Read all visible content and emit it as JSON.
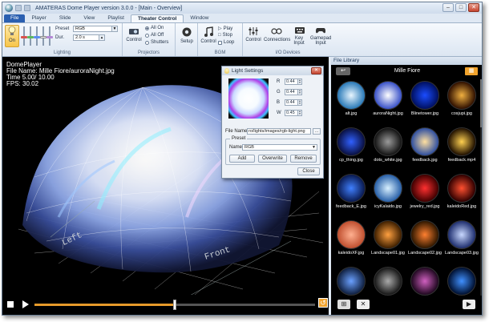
{
  "window": {
    "title": "AMATERAS Dome Player version 3.0.0 - [Main - Overview]",
    "colors": {
      "accent": "#f1a32d",
      "ribbon_blue": "#2a5fb0"
    }
  },
  "tabs": [
    {
      "label": "File"
    },
    {
      "label": "Player"
    },
    {
      "label": "Slide"
    },
    {
      "label": "View"
    },
    {
      "label": "Playlist"
    },
    {
      "label": "Theater Control"
    },
    {
      "label": "Window"
    }
  ],
  "ribbon": {
    "lighting": {
      "label": "Lighting",
      "on_label": "On",
      "preset_label": "Preset",
      "preset_value": "RGB",
      "dur_label": "Dur.",
      "dur_value": "2.0 s"
    },
    "projectors": {
      "label": "Projectors",
      "control_label": "Control",
      "all_on": "All On",
      "all_off": "All Off",
      "shutters": "Shutters"
    },
    "setup": {
      "label": "Setup"
    },
    "bgm": {
      "label": "BGM",
      "control_label": "Control",
      "play": "Play",
      "stop": "Stop",
      "loop": "Loop"
    },
    "io": {
      "label": "I/O Devices",
      "control": "Control",
      "connections": "Connections",
      "key_input": "Key Input",
      "gamepad_input": "Gamepad Input"
    }
  },
  "viewport": {
    "player_name": "DomePlayer",
    "file_line": "File Name: Mille Fiore/auroraNight.jpg",
    "time_line": "Time    5.00/ 10.00",
    "fps_line": "FPS: 30.02",
    "label_left": "Left",
    "label_front": "Front"
  },
  "transport": {
    "progress": 0.5,
    "stop_icon": "stop-icon",
    "play_icon": "play-icon",
    "loop_icon": "loop-icon"
  },
  "light_settings": {
    "title": "Light Settings",
    "r_label": "R",
    "r_value": "0.44",
    "g_label": "G",
    "g_value": "0.44",
    "b_label": "B",
    "b_value": "0.44",
    "w_label": "W",
    "w_value": "0.45",
    "file_name_label": "File Name",
    "file_name_value": "ro/lights/images/rgb-light.png",
    "preset_group": "Preset",
    "name_label": "Name",
    "name_value": "RGB",
    "add_label": "Add",
    "overwrite_label": "Overwrite",
    "remove_label": "Remove",
    "close_label": "Close"
  },
  "library": {
    "title": "File Library",
    "folder": "Mille Fiore",
    "items": [
      {
        "name": "alt.jpg",
        "c1": "#e8f6ff",
        "c2": "#2a7ab8"
      },
      {
        "name": "auroraNight.jpg",
        "c1": "#ffffff",
        "c2": "#3a52c8"
      },
      {
        "name": "Blinetower.jpg",
        "c1": "#1a4cff",
        "c2": "#001060"
      },
      {
        "name": "cosjupi.jpg",
        "c1": "#f0b040",
        "c2": "#301000"
      },
      {
        "name": "cp_thing.jpg",
        "c1": "#3060ff",
        "c2": "#0a1040"
      },
      {
        "name": "dots_white.jpg",
        "c1": "#9a9a9a",
        "c2": "#141414"
      },
      {
        "name": "feedback.jpg",
        "c1": "#ffe0a0",
        "c2": "#3050a0"
      },
      {
        "name": "feedback.mp4",
        "c1": "#ffd050",
        "c2": "#201000"
      },
      {
        "name": "feedback_E.jpg",
        "c1": "#4080ff",
        "c2": "#0a1a50"
      },
      {
        "name": "icyKalaido.jpg",
        "c1": "#d8f0ff",
        "c2": "#2860a8"
      },
      {
        "name": "jewelry_red.jpg",
        "c1": "#ff3030",
        "c2": "#400000"
      },
      {
        "name": "kaleidoRed.jpg",
        "c1": "#ff5030",
        "c2": "#300000"
      },
      {
        "name": "kaleidoXF.jpg",
        "c1": "#ffb090",
        "c2": "#c05030"
      },
      {
        "name": "Landscape01.jpg",
        "c1": "#ffa040",
        "c2": "#402000"
      },
      {
        "name": "Landscape02.jpg",
        "c1": "#ff8030",
        "c2": "#301800"
      },
      {
        "name": "Landscape03.jpg",
        "c1": "#c8d8ff",
        "c2": "#203070"
      },
      {
        "name": "",
        "c1": "#6aa0ff",
        "c2": "#102040"
      },
      {
        "name": "",
        "c1": "#aaaaaa",
        "c2": "#181818"
      },
      {
        "name": "",
        "c1": "#d060c0",
        "c2": "#200820"
      },
      {
        "name": "",
        "c1": "#4090ff",
        "c2": "#001030"
      }
    ]
  }
}
